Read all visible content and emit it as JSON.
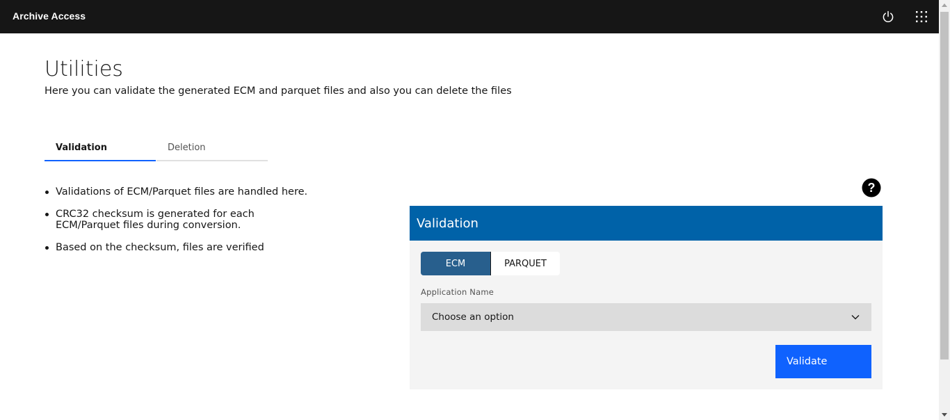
{
  "header": {
    "app_title": "Archive Access",
    "power_icon": "power-icon",
    "apps_icon": "app-switcher-grid-icon",
    "background_color": "#161616"
  },
  "page": {
    "title": "Utilities",
    "subtitle": "Here you can validate the generated ECM and parquet files and also you can delete the files"
  },
  "tabs": [
    {
      "label": "Validation",
      "selected": true
    },
    {
      "label": "Deletion",
      "selected": false
    }
  ],
  "info_list": [
    "Validations of ECM/Parquet files are handled here.",
    "CRC32 checksum is generated for each\nECM/Parquet files during conversion.",
    "Based on the checksum, files are verified"
  ],
  "help": {
    "icon": "help-question-icon"
  },
  "validation_panel": {
    "title": "Validation",
    "header_color": "#0062a8",
    "file_type_options": [
      {
        "label": "ECM",
        "selected": true
      },
      {
        "label": "PARQUET",
        "selected": false
      }
    ],
    "application_field": {
      "label": "Application Name",
      "value": "Choose an option"
    },
    "validate_button": "Validate",
    "button_color": "#0f62fe"
  }
}
